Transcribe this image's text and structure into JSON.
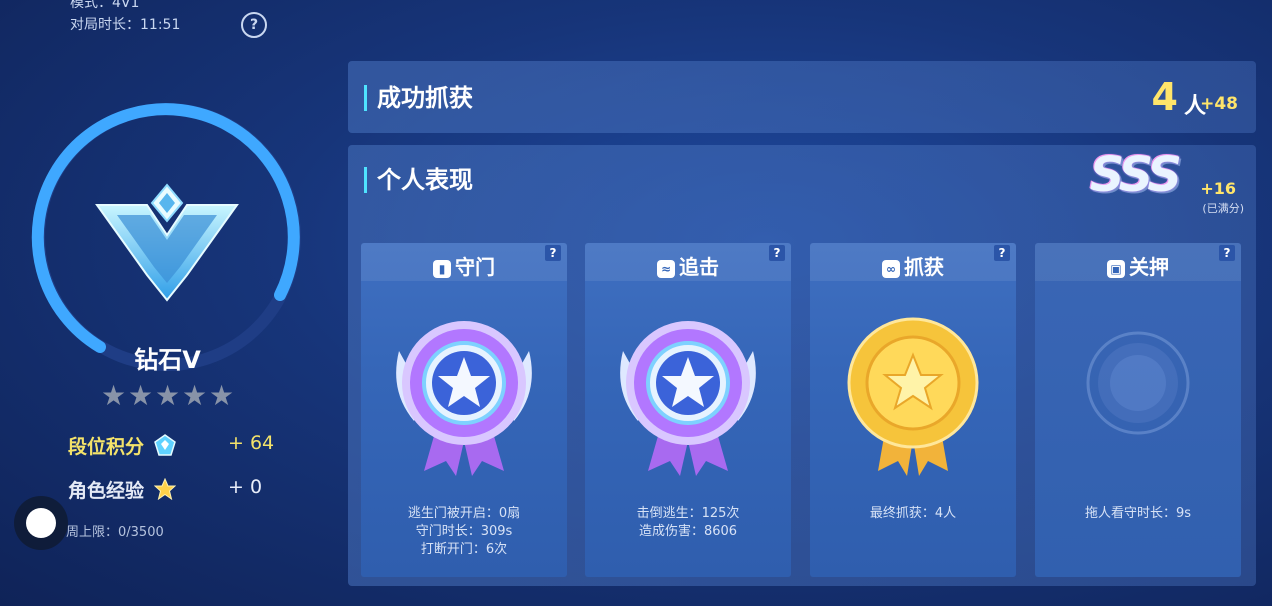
{
  "top": {
    "mode": "模式：4V1",
    "duration": "对局时长：11:51",
    "help": "?"
  },
  "rank": {
    "name": "钻石V",
    "stars": [
      "★",
      "★",
      "★",
      "★",
      "★"
    ],
    "points_label": "段位积分",
    "points_value": "+ 64",
    "exp_label": "角色经验",
    "exp_value": "+ 0",
    "weekly_limit": "周上限：0/3500"
  },
  "catch": {
    "title": "成功抓获",
    "count": "4",
    "unit": "人",
    "bonus": "+48"
  },
  "performance": {
    "title": "个人表现",
    "grade": "SSS",
    "grade_bonus": "+16",
    "grade_note": "(已满分)",
    "cards": [
      {
        "title": "守门",
        "icon": "▮",
        "help": "?",
        "lines": [
          "逃生门被开启：0扇",
          "守门时长：309s",
          "打断开门：6次"
        ]
      },
      {
        "title": "追击",
        "icon": "≈",
        "help": "?",
        "lines": [
          "击倒逃生：125次",
          "造成伤害：8606"
        ]
      },
      {
        "title": "抓获",
        "icon": "∞",
        "help": "?",
        "lines": [
          "最终抓获：4人"
        ]
      },
      {
        "title": "关押",
        "icon": "▣",
        "help": "?",
        "lines": [
          "拖人看守时长：9s"
        ]
      }
    ]
  },
  "colors": {
    "accent_cyan": "#4fe3ff",
    "gold": "#ffe56a",
    "ring_blue": "#3fa8ff"
  }
}
